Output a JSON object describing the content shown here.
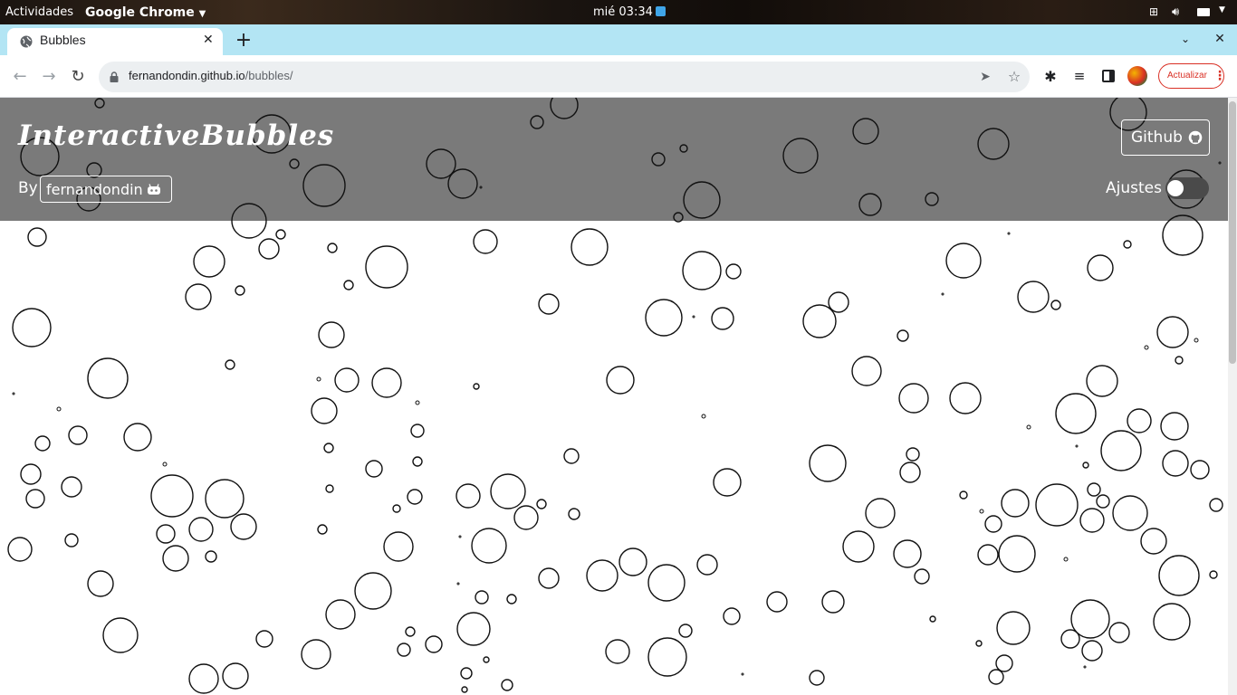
{
  "system_bar": {
    "activities": "Actividades",
    "app_menu": "Google Chrome",
    "clock": "mié 03:34"
  },
  "browser": {
    "tab_title": "Bubbles",
    "url_domain": "fernandondin.github.io",
    "url_path": "/bubbles/",
    "update_label": "Actualizar",
    "accent_color": "#b3e5f4"
  },
  "site": {
    "title": "InteractiveBubbles",
    "by_label": "By",
    "author": "fernandondin",
    "github_label": "Github",
    "settings_label": "Ajustes",
    "settings_enabled": false
  },
  "colors": {
    "header_bg": "#7a7a7a",
    "bubble_stroke": "#111111"
  }
}
